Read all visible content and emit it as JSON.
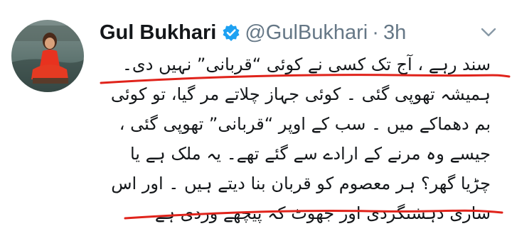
{
  "tweet": {
    "display_name": "Gul Bukhari",
    "handle": "@GulBukhari",
    "separator": "·",
    "time": "3h",
    "icons": {
      "avatar": "profile-avatar",
      "verified": "verified-badge-icon",
      "menu": "chevron-down-icon"
    },
    "colors": {
      "verified": "#1da1f2",
      "underline": "#e0231b",
      "secondary_text": "#657786"
    },
    "lines": [
      "سند رہے ، آج تک کسی نے کوئی “قربانی” نہیں دی۔",
      "ہمیشہ تھوپی گئی ۔ کوئی جہاز چلاتے مر گیا، تو کوئی",
      "بم دھماکے میں ۔ سب کے اوپر “قربانی” تھوپی گئی ،",
      "جیسے وہ مرنے کے ارادے سے گئے تھے۔ یہ ملک ہے یا",
      "چڑیا گھر؟ ہر معصوم کو قربان بنا دیتے ہیں ۔ اور اس",
      "ساری دہشتگردی اور جھوٹ کہ پیچھے وردی ہے"
    ]
  }
}
